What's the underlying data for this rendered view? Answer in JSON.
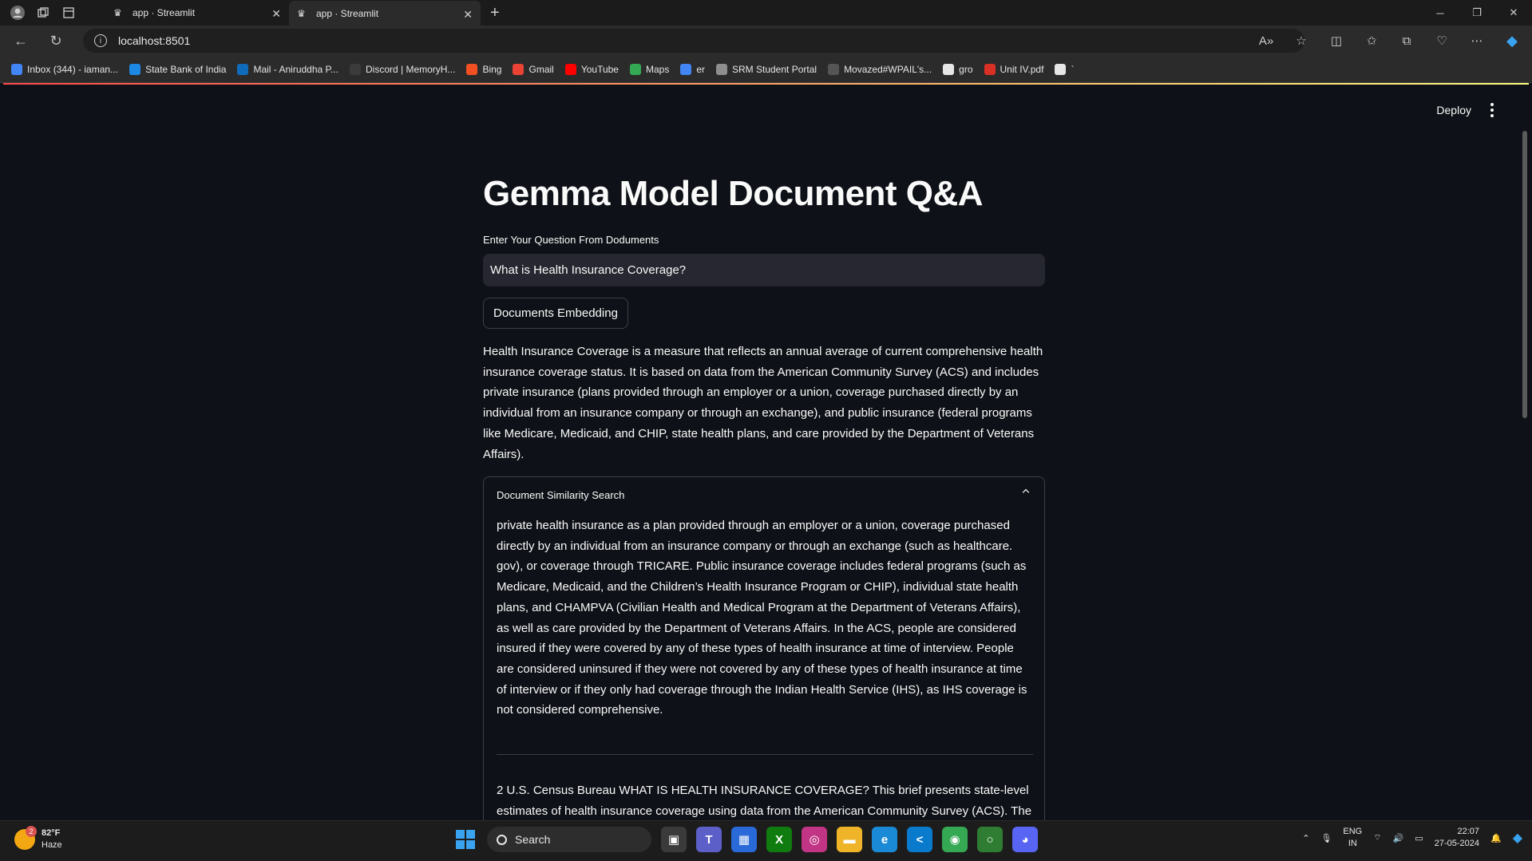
{
  "browser": {
    "tabs": [
      {
        "label": "app · Streamlit"
      },
      {
        "label": "app · Streamlit"
      }
    ],
    "url": "localhost:8501",
    "bookmarks": [
      {
        "label": "Inbox (344) - iaman...",
        "icon": "google-icon",
        "color": "#4285f4"
      },
      {
        "label": "State Bank of India",
        "icon": "sbi-icon",
        "color": "#1e88e5"
      },
      {
        "label": "Mail - Aniruddha P...",
        "icon": "outlook-icon",
        "color": "#0f6cbd"
      },
      {
        "label": "Discord | MemoryH...",
        "icon": "discord-icon",
        "color": "#3b3b3b"
      },
      {
        "label": "Bing",
        "icon": "bing-icon",
        "color": "#f25022"
      },
      {
        "label": "Gmail",
        "icon": "gmail-icon",
        "color": "#ea4335"
      },
      {
        "label": "YouTube",
        "icon": "youtube-icon",
        "color": "#ff0000"
      },
      {
        "label": "Maps",
        "icon": "maps-icon",
        "color": "#34a853"
      },
      {
        "label": "er",
        "icon": "google-icon",
        "color": "#4285f4"
      },
      {
        "label": "SRM Student Portal",
        "icon": "srm-icon",
        "color": "#8e8e8e"
      },
      {
        "label": "Movazed#WPAIL's...",
        "icon": "movie-icon",
        "color": "#555555"
      },
      {
        "label": "gro",
        "icon": "github-icon",
        "color": "#e6e6e6"
      },
      {
        "label": "Unit IV.pdf",
        "icon": "pdf-icon",
        "color": "#d93025"
      },
      {
        "label": "`",
        "icon": "github-icon",
        "color": "#e6e6e6"
      }
    ]
  },
  "app": {
    "deploy_label": "Deploy",
    "title": "Gemma Model Document Q&A",
    "question_label": "Enter Your Question From Doduments",
    "question_value": "What is Health Insurance Coverage?",
    "embed_button": "Documents Embedding",
    "answer": "Health Insurance Coverage is a measure that reflects an annual average of current comprehensive health insurance coverage status. It is based on data from the American Community Survey (ACS) and includes private insurance (plans provided through an employer or a union, coverage purchased directly by an individual from an insurance company or through an exchange), and public insurance (federal programs like Medicare, Medicaid, and CHIP, state health plans, and care provided by the Department of Veterans Affairs).",
    "expander": {
      "title": "Document Similarity Search",
      "doc1": "private health insurance as a plan provided through an employer or a union, coverage purchased directly by an individual from an insurance company or through an exchange (such as healthcare. gov), or coverage through TRICARE. Public insurance coverage includes federal programs (such as Medicare, Medicaid, and the Children’s Health Insurance Program or CHIP), individual state health plans, and CHAMPVA (Civilian Health and Medical Program at the Department of Veterans Affairs), as well as care provided by the Department of Veterans Affairs. In the ACS, people are considered insured if they were covered by any of these types of health insurance at time of interview. People are considered uninsured if they were not covered by any of these types of health insurance at time of interview or if they only had coverage through the Indian Health Service (IHS), as IHS coverage is not considered comprehensive.",
      "doc2": "2 U.S. Census Bureau WHAT IS HEALTH INSURANCE COVERAGE? This brief presents state-level estimates of health insurance coverage using data from the American Community Survey (ACS). The"
    }
  },
  "taskbar": {
    "weather_badge": "2",
    "temperature": "82°F",
    "condition": "Haze",
    "search_label": "Search",
    "lang_top": "ENG",
    "lang_bottom": "IN",
    "time": "22:07",
    "date": "27-05-2024",
    "apps": [
      {
        "name": "task-view-icon",
        "glyph": "▣",
        "color": "#3a3a3a"
      },
      {
        "name": "teams-icon",
        "glyph": "T",
        "color": "#5b5fc7"
      },
      {
        "name": "store-icon",
        "glyph": "▦",
        "color": "#2a6ad8"
      },
      {
        "name": "xbox-icon",
        "glyph": "X",
        "color": "#107c10"
      },
      {
        "name": "instagram-icon",
        "glyph": "◎",
        "color": "#c13584"
      },
      {
        "name": "file-explorer-icon",
        "glyph": "▬",
        "color": "#f0b429"
      },
      {
        "name": "edge-icon",
        "glyph": "e",
        "color": "#1b8ad6"
      },
      {
        "name": "vscode-icon",
        "glyph": "<",
        "color": "#0a7acc"
      },
      {
        "name": "chrome-icon",
        "glyph": "◉",
        "color": "#34a853"
      },
      {
        "name": "ring-app-icon",
        "glyph": "○",
        "color": "#2e7d32"
      },
      {
        "name": "discord-icon",
        "glyph": "◕",
        "color": "#5865f2"
      }
    ]
  }
}
